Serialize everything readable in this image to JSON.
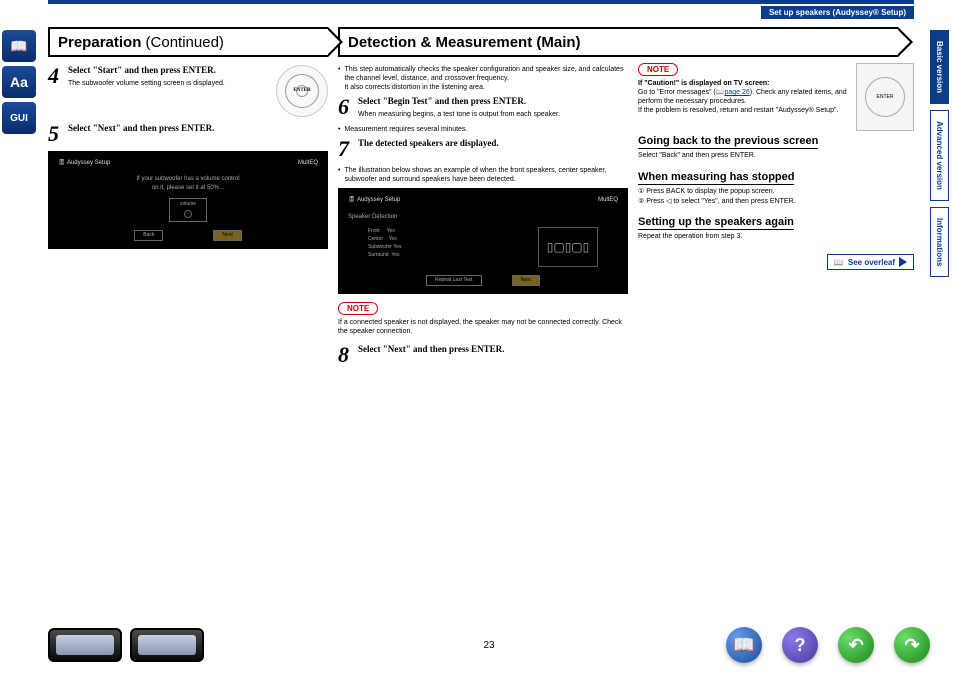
{
  "header": {
    "tag": "Set up speakers (Audyssey® Setup)"
  },
  "leftTabs": [
    "📖",
    "Aa",
    "GUI"
  ],
  "rightTabs": [
    {
      "label": "Basic version",
      "active": true
    },
    {
      "label": "Advanced version",
      "active": false
    },
    {
      "label": "Informations",
      "active": false
    }
  ],
  "col1": {
    "title": "Preparation",
    "titleSub": " (Continued)",
    "step4": {
      "num": "4",
      "text": "Select \"Start\" and then press ENTER.",
      "desc": "The subwoofer volume setting screen is displayed."
    },
    "step5": {
      "num": "5",
      "text": "Select \"Next\" and then press ENTER."
    },
    "screen": {
      "title": "Audyssey Setup",
      "badge": "MultEQ",
      "line1": "If your subwoofer has a volume control",
      "line2": "on it, please set it at 50%...",
      "vol": "volume",
      "btnL": "Back",
      "btnR": "Next"
    }
  },
  "col2": {
    "title": "Detection & Measurement (Main)",
    "intro1": "This step automatically checks the speaker configuration and speaker size, and calculates the channel level, distance, and crossover frequency.",
    "intro2": "It also corrects distortion in the listening area.",
    "step6": {
      "num": "6",
      "text": "Select \"Begin Test\" and then press ENTER.",
      "desc": "When measuring begins, a test tone is output from each speaker."
    },
    "bullet6": "Measurement requires several minutes.",
    "step7": {
      "num": "7",
      "text": "The detected speakers are displayed."
    },
    "bullet7": "The illustration below shows an example of when the front speakers, center speaker, subwoofer and surround speakers have been detected.",
    "screen": {
      "title": "Audyssey Setup",
      "sub": "Speaker Detection",
      "badge": "MultEQ",
      "rows": [
        [
          "Front",
          "Yes"
        ],
        [
          "Center",
          "Yes"
        ],
        [
          "Subwoofer",
          "Yes"
        ],
        [
          "Surround",
          "Yes"
        ]
      ],
      "btnL": "Repeat Last Test",
      "btnR": "Next"
    },
    "noteLabel": "NOTE",
    "noteText": "If a connected speaker is not displayed, the speaker may not be connected correctly. Check the speaker connection.",
    "step8": {
      "num": "8",
      "text": "Select \"Next\" and then press ENTER."
    }
  },
  "col3": {
    "noteLabel": "NOTE",
    "noteTitle": "If \"Caution!\" is displayed on TV screen:",
    "noteBody1": "Go to \"Error messages\" (",
    "noteLink": "page 26",
    "noteBody2": "). Check any related items, and perform the necessary procedures.",
    "noteBody3": "If the problem is resolved, return and restart \"Audyssey® Setup\".",
    "h1": "Going back to the previous screen",
    "t1": "Select \"Back\" and then press ENTER.",
    "h2": "When measuring has stopped",
    "t2a": "① Press BACK to display the popup screen.",
    "t2b": "② Press ◁ to select \"Yes\", and then press ENTER.",
    "h3": "Setting up the speakers again",
    "t3": "Repeat the operation from step 3.",
    "overleaf": "See overleaf"
  },
  "footer": {
    "page": "23"
  }
}
